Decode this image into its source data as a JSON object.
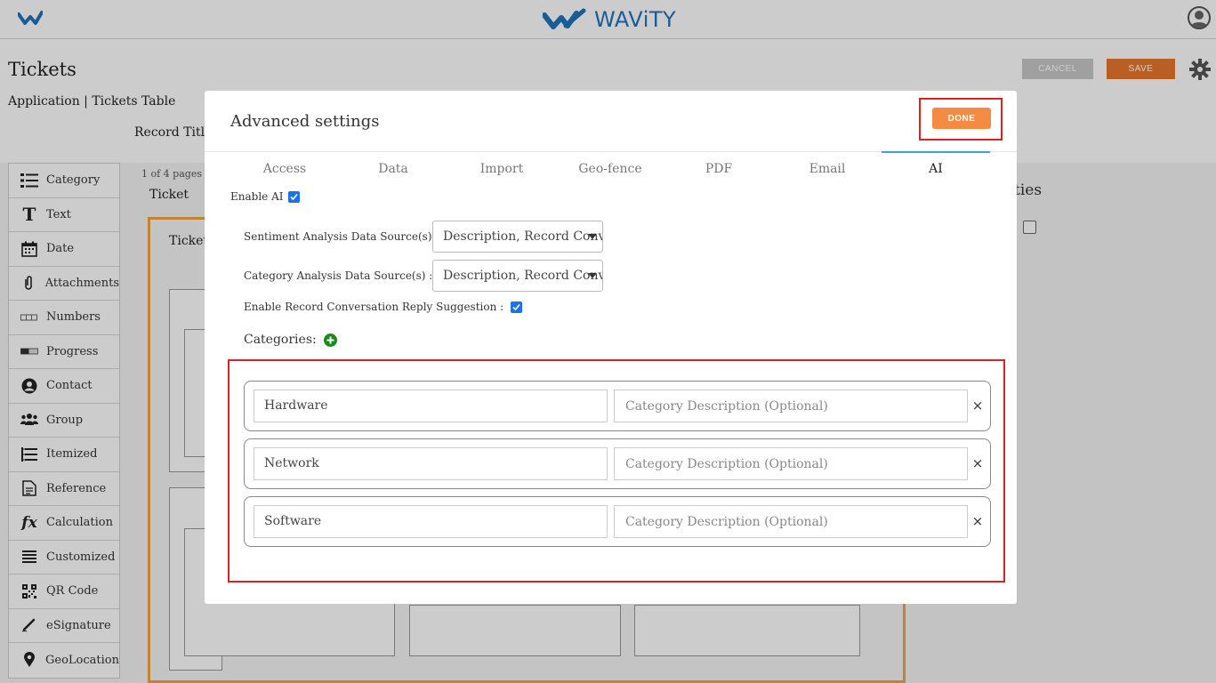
{
  "app": {
    "brand": "WAViTY"
  },
  "page": {
    "title": "Tickets",
    "breadcrumb": "Application | Tickets Table",
    "record_title_label": "Record Title",
    "cancel_label": "CANCEL",
    "save_label": "SAVE",
    "pages_text": "1 of 4 pages",
    "ticket_label": "Ticket",
    "canvas_ticket_label": "Ticket",
    "properties_partial": "ties"
  },
  "palette": [
    {
      "icon": "list-icon",
      "label": "Category"
    },
    {
      "icon": "text-icon",
      "label": "Text"
    },
    {
      "icon": "calendar-icon",
      "label": "Date"
    },
    {
      "icon": "paperclip-icon",
      "label": "Attachments"
    },
    {
      "icon": "numbers-icon",
      "label": "Numbers"
    },
    {
      "icon": "progress-icon",
      "label": "Progress"
    },
    {
      "icon": "contact-icon",
      "label": "Contact"
    },
    {
      "icon": "group-icon",
      "label": "Group"
    },
    {
      "icon": "itemized-icon",
      "label": "Itemized"
    },
    {
      "icon": "document-icon",
      "label": "Reference"
    },
    {
      "icon": "function-icon",
      "label": "Calculation"
    },
    {
      "icon": "customized-icon",
      "label": "Customized"
    },
    {
      "icon": "qr-icon",
      "label": "QR Code"
    },
    {
      "icon": "pen-icon",
      "label": "eSignature"
    },
    {
      "icon": "location-pin-icon",
      "label": "GeoLocation"
    }
  ],
  "modal": {
    "title": "Advanced settings",
    "done_label": "DONE",
    "tabs": [
      {
        "label": "Access"
      },
      {
        "label": "Data"
      },
      {
        "label": "Import"
      },
      {
        "label": "Geo-fence"
      },
      {
        "label": "PDF"
      },
      {
        "label": "Email"
      },
      {
        "label": "AI"
      }
    ],
    "active_tab": "AI",
    "enable_ai_label": "Enable AI",
    "enable_ai_checked": true,
    "sentiment_label": "Sentiment Analysis Data Source(s) :",
    "sentiment_value": "Description, Record Conversation",
    "category_source_label": "Category Analysis Data Source(s) :",
    "category_source_value": "Description, Record Conversation",
    "reply_label": "Enable Record Conversation Reply Suggestion :",
    "reply_checked": true,
    "categories_label": "Categories:",
    "categories": [
      {
        "name": "Hardware",
        "description_placeholder": "Category Description (Optional)"
      },
      {
        "name": "Network",
        "description_placeholder": "Category Description (Optional)"
      },
      {
        "name": "Software",
        "description_placeholder": "Category Description (Optional)"
      }
    ],
    "remove_symbol": "×"
  },
  "colors": {
    "brand": "#1e73be",
    "save": "#e8772e",
    "done": "#f58a42",
    "highlight": "#e02020",
    "active_tab": "#3aa0e8",
    "checkbox": "#1a73e8",
    "add": "#1a8a1a"
  }
}
